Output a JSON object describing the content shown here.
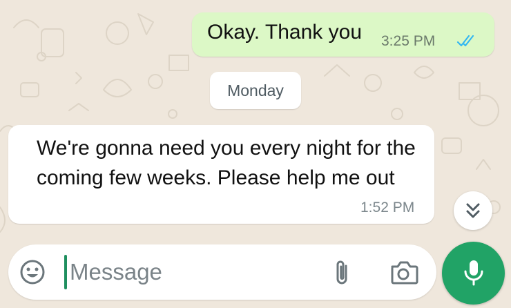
{
  "conversation": {
    "messages": [
      {
        "direction": "outgoing",
        "text": "Okay. Thank you",
        "time": "3:25 PM",
        "status": "read"
      },
      {
        "direction": "incoming",
        "text": "We're gonna need you every night for the coming few weeks. Please help me out",
        "time": "1:52 PM"
      }
    ],
    "day_separator": "Monday"
  },
  "composer": {
    "placeholder": "Message"
  },
  "icons": {
    "emoji": "smiley-icon",
    "attach": "paperclip-icon",
    "camera": "camera-icon",
    "mic": "microphone-icon",
    "scroll_down": "double-chevron-down-icon",
    "read_receipt": "double-check-icon"
  },
  "colors": {
    "chat_background": "#efe7dc",
    "outgoing_bubble": "#dcf8c6",
    "incoming_bubble": "#ffffff",
    "read_ticks": "#34b7f1",
    "mic_button": "#21a366",
    "caret": "#1f8f5f"
  }
}
